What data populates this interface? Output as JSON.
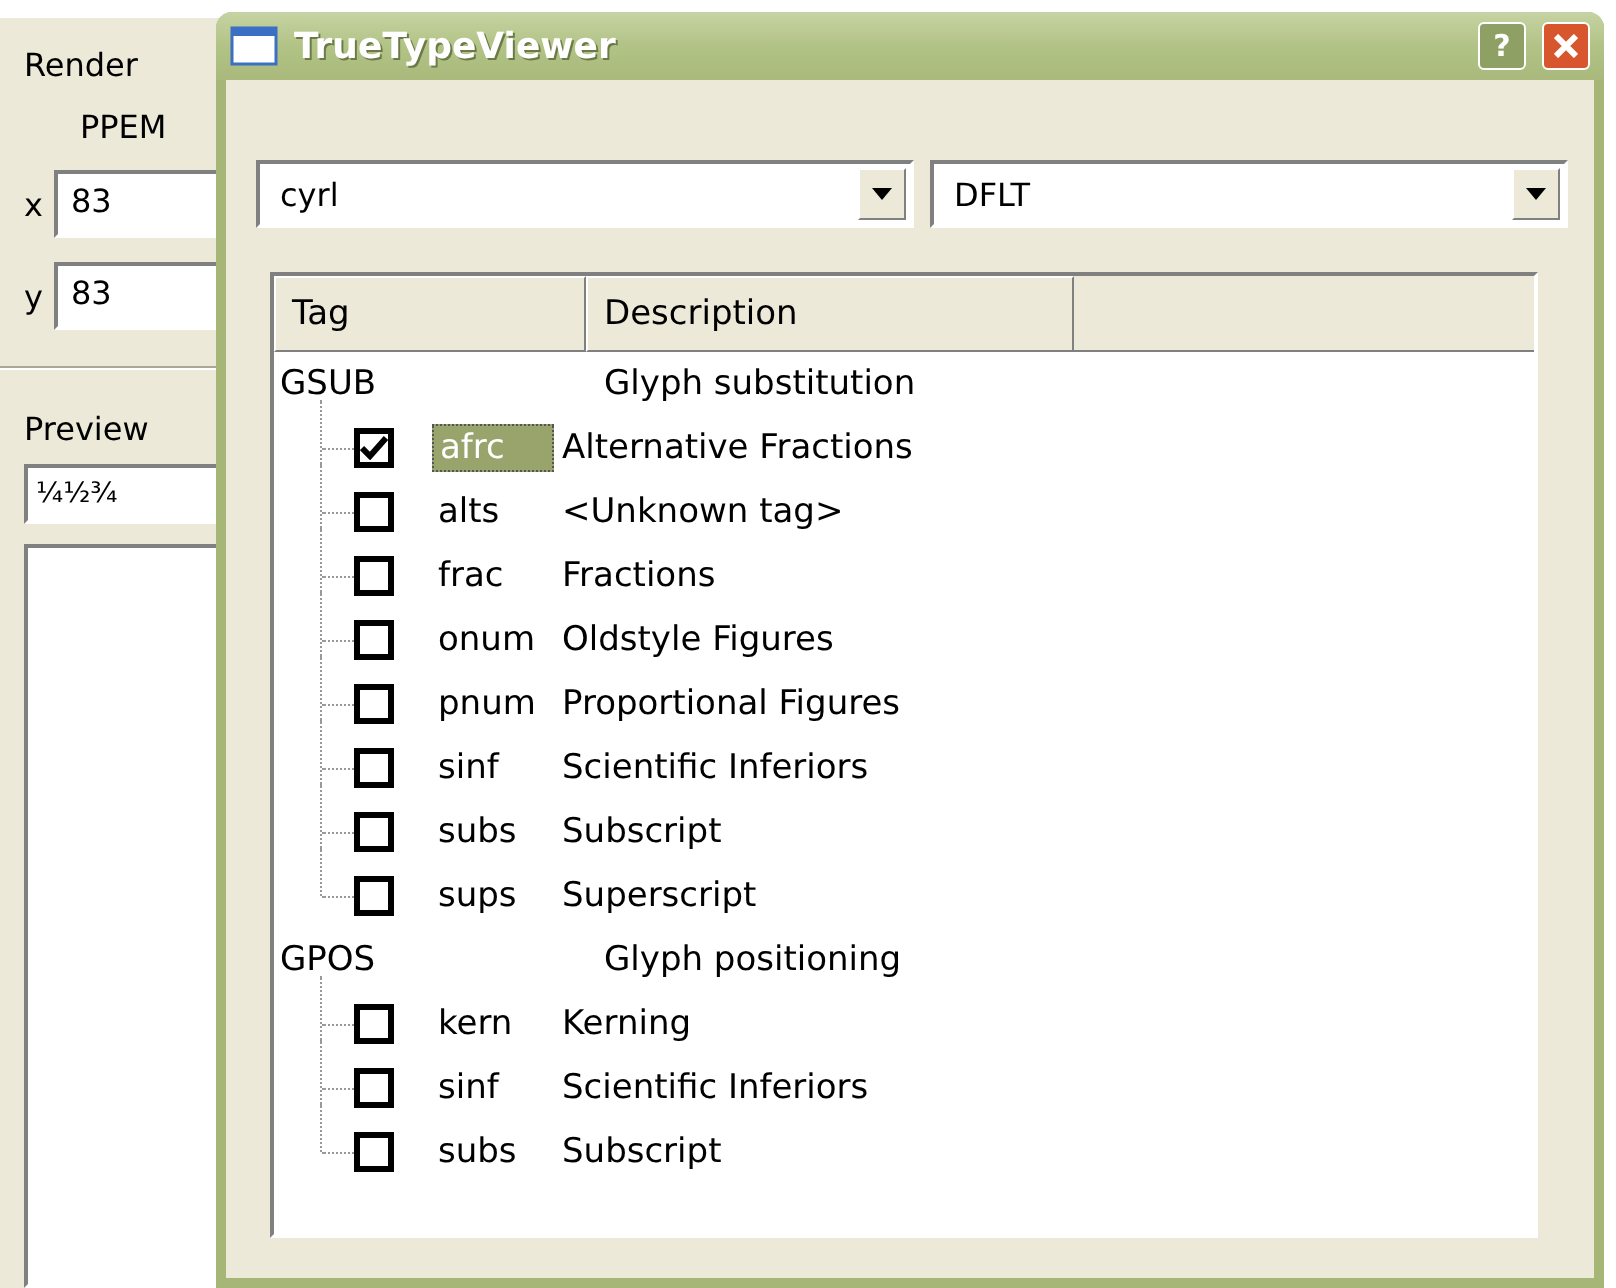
{
  "background_window": {
    "group_label": "Render",
    "ppem_label": "PPEM",
    "fields": [
      {
        "label": "x",
        "value": "83"
      },
      {
        "label": "y",
        "value": "83"
      }
    ],
    "preview_label": "Preview",
    "preview_text": "¼½¾"
  },
  "dialog": {
    "title": "TrueTypeViewer",
    "help_button": "?",
    "script_combo": {
      "value": "cyrl"
    },
    "language_combo": {
      "value": "DFLT"
    },
    "tree": {
      "columns": [
        "Tag",
        "Description"
      ],
      "groups": [
        {
          "tag": "GSUB",
          "description": "Glyph substitution",
          "children": [
            {
              "tag": "afrc",
              "description": "Alternative Fractions",
              "checked": true,
              "selected": true
            },
            {
              "tag": "alts",
              "description": "<Unknown tag>",
              "checked": false,
              "selected": false
            },
            {
              "tag": "frac",
              "description": "Fractions",
              "checked": false,
              "selected": false
            },
            {
              "tag": "onum",
              "description": "Oldstyle Figures",
              "checked": false,
              "selected": false
            },
            {
              "tag": "pnum",
              "description": "Proportional Figures",
              "checked": false,
              "selected": false
            },
            {
              "tag": "sinf",
              "description": "Scientific Inferiors",
              "checked": false,
              "selected": false
            },
            {
              "tag": "subs",
              "description": "Subscript",
              "checked": false,
              "selected": false
            },
            {
              "tag": "sups",
              "description": "Superscript",
              "checked": false,
              "selected": false
            }
          ]
        },
        {
          "tag": "GPOS",
          "description": "Glyph positioning",
          "children": [
            {
              "tag": "kern",
              "description": "Kerning",
              "checked": false,
              "selected": false
            },
            {
              "tag": "sinf",
              "description": "Scientific Inferiors",
              "checked": false,
              "selected": false
            },
            {
              "tag": "subs",
              "description": "Subscript",
              "checked": false,
              "selected": false
            }
          ]
        }
      ]
    }
  }
}
